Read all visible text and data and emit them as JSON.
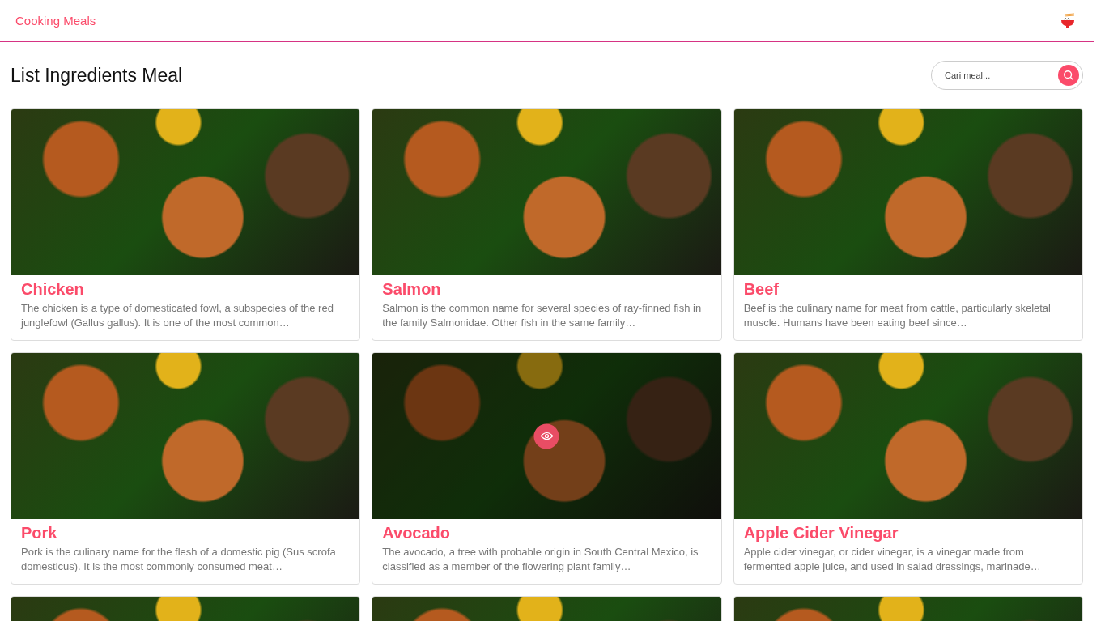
{
  "navbar": {
    "brand": "Cooking Meals"
  },
  "heading": "List Ingredients Meal",
  "search": {
    "placeholder": "Cari meal..."
  },
  "cards": [
    {
      "kind": "full",
      "title": "Chicken",
      "description": "The chicken is a type of domesticated fowl, a subspecies of the red junglefowl (Gallus gallus). It is one of the most common…",
      "hovered": false
    },
    {
      "kind": "full",
      "title": "Salmon",
      "description": "Salmon is the common name for several species of ray-finned fish in the family Salmonidae. Other fish in the same family…",
      "hovered": false
    },
    {
      "kind": "full",
      "title": "Beef",
      "description": "Beef is the culinary name for meat from cattle, particularly skeletal muscle. Humans have been eating beef since…",
      "hovered": false
    },
    {
      "kind": "full",
      "title": "Pork",
      "description": "Pork is the culinary name for the flesh of a domestic pig (Sus scrofa domesticus). It is the most commonly consumed meat…",
      "hovered": false
    },
    {
      "kind": "full",
      "title": "Avocado",
      "description": "The avocado, a tree with probable origin in South Central Mexico, is classified as a member of the flowering plant family…",
      "hovered": true
    },
    {
      "kind": "full",
      "title": "Apple Cider Vinegar",
      "description": "Apple cider vinegar, or cider vinegar, is a vinegar made from fermented apple juice, and used in salad dressings, marinade…",
      "hovered": false
    },
    {
      "kind": "cut",
      "hovered": false
    },
    {
      "kind": "cut",
      "hovered": false
    },
    {
      "kind": "cut",
      "hovered": false
    }
  ]
}
